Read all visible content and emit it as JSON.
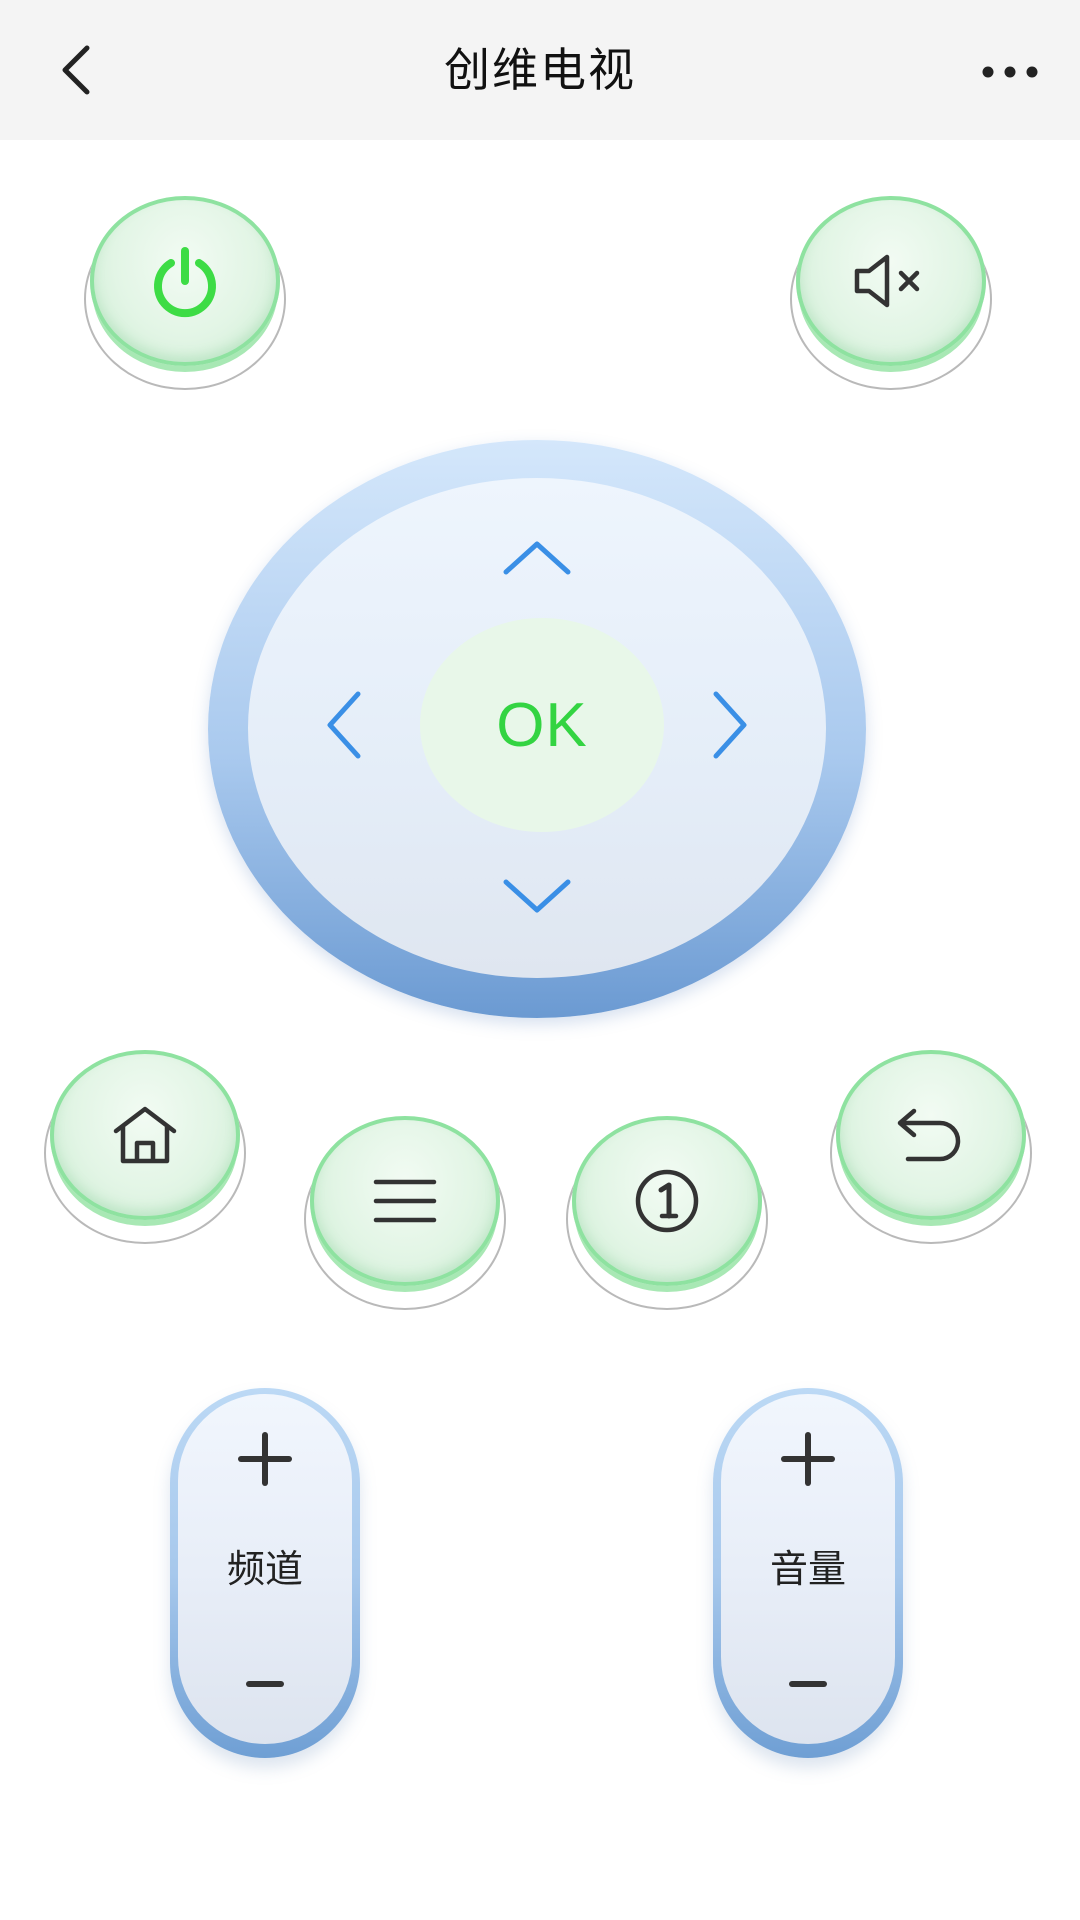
{
  "header": {
    "title": "创维电视",
    "back_icon": "chevron-left-icon",
    "more_icon": "more-horizontal-icon"
  },
  "buttons": {
    "power": {
      "icon": "power-icon"
    },
    "mute": {
      "icon": "volume-mute-icon"
    },
    "home": {
      "icon": "home-icon"
    },
    "menu": {
      "icon": "menu-icon"
    },
    "number": {
      "icon": "number-one-circle-icon"
    },
    "return": {
      "icon": "return-icon"
    }
  },
  "dpad": {
    "ok_label": "OK",
    "up_icon": "chevron-up-icon",
    "down_icon": "chevron-down-icon",
    "left_icon": "chevron-left-icon",
    "right_icon": "chevron-right-icon"
  },
  "channel": {
    "label": "频道",
    "plus": "+",
    "minus": "-"
  },
  "volume": {
    "label": "音量",
    "plus": "+",
    "minus": "-"
  },
  "colors": {
    "power_green": "#3ddc45",
    "ok_green": "#33d442",
    "arrow_blue": "#3a8fe6",
    "button_border": "#8ee2a0",
    "ring_blue": "#6b9ad2",
    "header_bg": "#f4f4f4"
  }
}
